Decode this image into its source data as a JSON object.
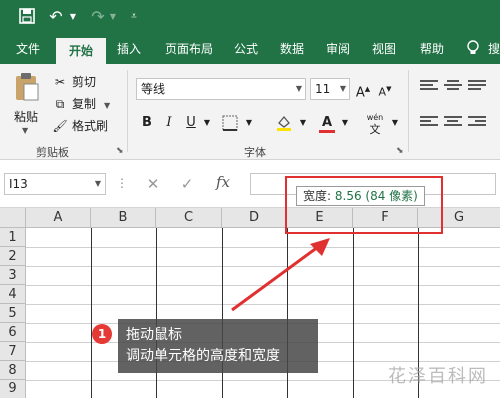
{
  "quick_access": {
    "save_icon": "save-icon",
    "undo_icon": "undo-icon",
    "redo_icon": "redo-icon"
  },
  "tabs": [
    {
      "label": "文件",
      "active": false
    },
    {
      "label": "开始",
      "active": true
    },
    {
      "label": "插入",
      "active": false
    },
    {
      "label": "页面布局",
      "active": false
    },
    {
      "label": "公式",
      "active": false
    },
    {
      "label": "数据",
      "active": false
    },
    {
      "label": "审阅",
      "active": false
    },
    {
      "label": "视图",
      "active": false
    },
    {
      "label": "帮助",
      "active": false
    }
  ],
  "tab_cut_label": "搜",
  "ribbon": {
    "clipboard": {
      "paste_label": "粘贴",
      "cut_label": "剪切",
      "copy_label": "复制",
      "format_painter_label": "格式刷",
      "group_label": "剪贴板"
    },
    "font": {
      "font_name": "等线",
      "font_size": "11",
      "bold_label": "B",
      "italic_label": "I",
      "underline_label": "U",
      "font_color_label": "A",
      "wen_label": "wén",
      "group_label": "字体"
    }
  },
  "formula_bar": {
    "name_box": "I13",
    "cancel_label": "✕",
    "enter_label": "✓",
    "fx_label": "fx"
  },
  "grid": {
    "columns": [
      "A",
      "B",
      "C",
      "D",
      "E",
      "F",
      "G"
    ],
    "rows": [
      "1",
      "2",
      "3",
      "4",
      "5",
      "6",
      "7",
      "8",
      "9"
    ]
  },
  "tooltip": {
    "label": "宽度:",
    "value": "8.56 (84 像素)"
  },
  "callout": {
    "step": "1",
    "line1": "拖动鼠标",
    "line2": "调动单元格的高度和宽度"
  },
  "watermark": "花泽百科网",
  "colors": {
    "brand": "#217346",
    "annotation": "#e03030"
  }
}
